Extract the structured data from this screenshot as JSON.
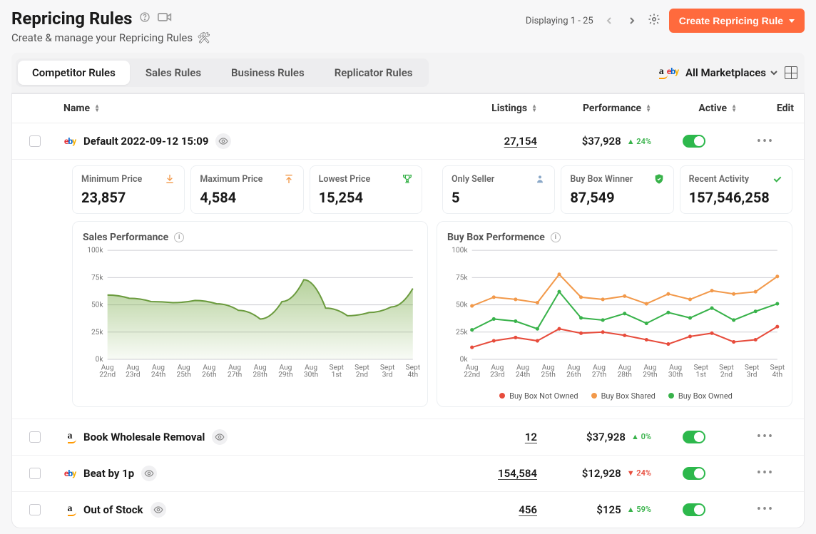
{
  "header": {
    "title": "Repricing Rules",
    "subtitle": "Create & manage your Repricing Rules",
    "displaying": "Displaying 1 - 25",
    "create_btn": "Create Repricing Rule"
  },
  "tabs": [
    {
      "label": "Competitor Rules",
      "active": true
    },
    {
      "label": "Sales Rules",
      "active": false
    },
    {
      "label": "Business Rules",
      "active": false
    },
    {
      "label": "Replicator Rules",
      "active": false
    }
  ],
  "marketplaces_label": "All Marketplaces",
  "columns": {
    "name": "Name",
    "listings": "Listings",
    "performance": "Performance",
    "active": "Active",
    "edit": "Edit"
  },
  "rows": [
    {
      "platform": "ebay",
      "name": "Default 2022-09-12 15:09",
      "listings": "27,154",
      "performance": "$37,928",
      "delta": "24%",
      "delta_dir": "up",
      "active": true,
      "expanded": true
    },
    {
      "platform": "amazon",
      "name": "Book Wholesale Removal",
      "listings": "12",
      "performance": "$37,928",
      "delta": "0%",
      "delta_dir": "up",
      "active": true
    },
    {
      "platform": "ebay",
      "name": "Beat by 1p",
      "listings": "154,584",
      "performance": "$12,928",
      "delta": "24%",
      "delta_dir": "down",
      "active": true
    },
    {
      "platform": "amazon",
      "name": "Out of Stock",
      "listings": "456",
      "performance": "$125",
      "delta": "59%",
      "delta_dir": "up",
      "active": true
    }
  ],
  "stat_cards": [
    {
      "label": "Minimum Price",
      "value": "23,857",
      "icon": "download"
    },
    {
      "label": "Maximum Price",
      "value": "4,584",
      "icon": "upload"
    },
    {
      "label": "Lowest Price",
      "value": "15,254",
      "icon": "trophy"
    },
    {
      "label": "Only Seller",
      "value": "5",
      "icon": "person"
    },
    {
      "label": "Buy Box Winner",
      "value": "87,549",
      "icon": "shield"
    },
    {
      "label": "Recent Activity",
      "value": "157,546,258",
      "icon": "check"
    }
  ],
  "charts": {
    "sales": {
      "title": "Sales Performance"
    },
    "buybox": {
      "title": "Buy Box Performence"
    }
  },
  "legend": {
    "not_owned": "Buy Box Not Owned",
    "shared": "Buy Box Shared",
    "owned": "Buy Box Owned"
  },
  "colors": {
    "primary": "#ff6a3d",
    "green": "#7aac4b",
    "series_red": "#e74c3c",
    "series_orange": "#f2994a",
    "series_green": "#38b24a"
  },
  "chart_data": [
    {
      "type": "area",
      "title": "Sales Performance",
      "ylim": [
        0,
        100000
      ],
      "yticks": [
        "0k",
        "25k",
        "50k",
        "75k",
        "100k"
      ],
      "categories": [
        "Aug 22nd",
        "Aug 23rd",
        "Aug 24th",
        "Aug 25th",
        "Aug 26th",
        "Aug 27th",
        "Aug 28th",
        "Aug 29th",
        "Aug 30th",
        "Sept 1st",
        "Sept 2nd",
        "Sept 3rd",
        "Sept 4th"
      ],
      "values": [
        59000,
        56000,
        53000,
        52000,
        54000,
        51000,
        45000,
        37000,
        53000,
        73000,
        47000,
        40000,
        43000,
        48000,
        65000
      ]
    },
    {
      "type": "line",
      "title": "Buy Box Performence",
      "ylim": [
        0,
        100000
      ],
      "yticks": [
        "0k",
        "25k",
        "50k",
        "75k",
        "100k"
      ],
      "categories": [
        "Aug 22nd",
        "Aug 23rd",
        "Aug 24th",
        "Aug 25th",
        "Aug 26th",
        "Aug 27th",
        "Aug 28th",
        "Aug 29th",
        "Aug 30th",
        "Sept 1st",
        "Sept 2nd",
        "Sept 3rd",
        "Sept 4th"
      ],
      "series": [
        {
          "name": "Buy Box Not Owned",
          "color": "#e74c3c",
          "values": [
            11000,
            17000,
            20000,
            17000,
            28000,
            24000,
            25000,
            22000,
            18000,
            14000,
            21000,
            24000,
            16000,
            18000,
            30000
          ]
        },
        {
          "name": "Buy Box Shared",
          "color": "#f2994a",
          "values": [
            49000,
            57000,
            55000,
            52000,
            78000,
            57000,
            55000,
            58000,
            51000,
            60000,
            55000,
            63000,
            60000,
            62000,
            76000
          ]
        },
        {
          "name": "Buy Box Owned",
          "color": "#38b24a",
          "values": [
            27000,
            37000,
            35000,
            28000,
            62000,
            38000,
            36000,
            42000,
            33000,
            43000,
            38000,
            47000,
            36000,
            44000,
            51000
          ]
        }
      ]
    }
  ]
}
